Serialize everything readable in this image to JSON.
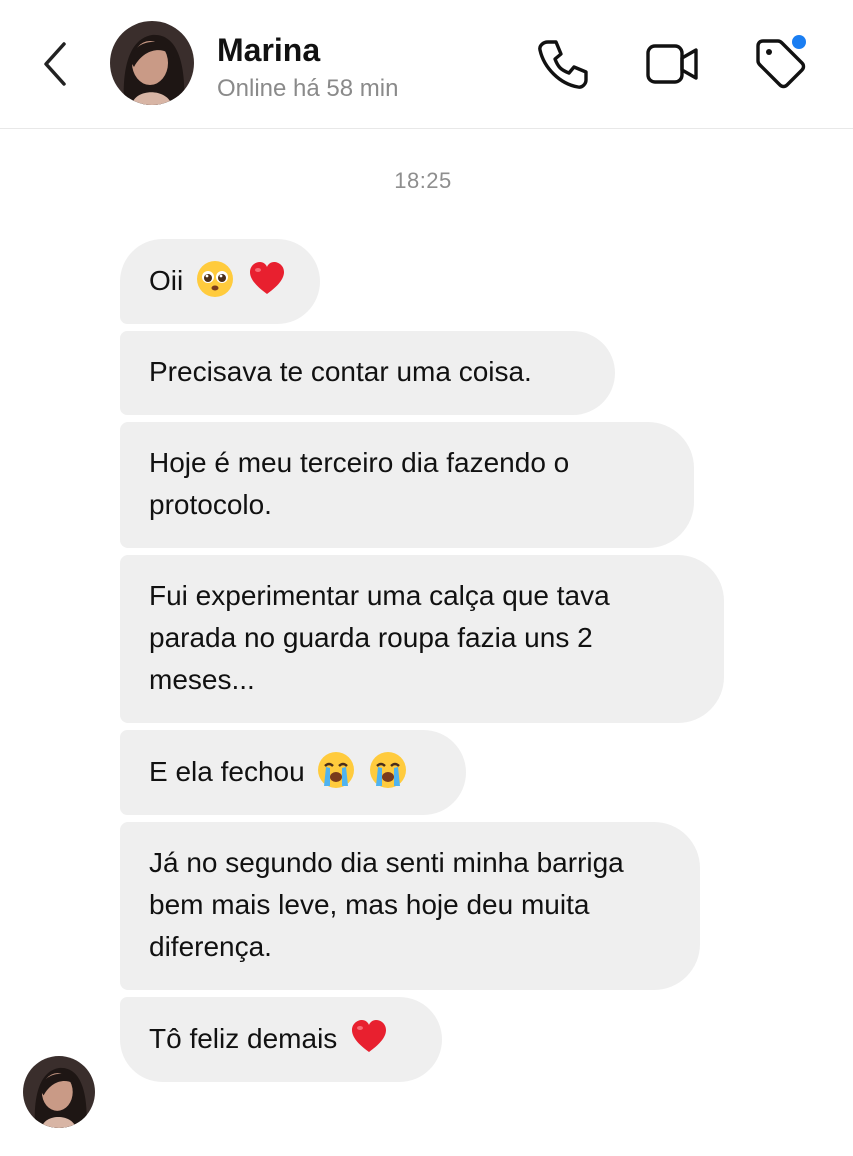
{
  "header": {
    "name": "Marina",
    "status": "Online há 58 min"
  },
  "chat": {
    "timestamp": "18:25",
    "messages": [
      {
        "text": "Oii",
        "emojis": [
          "pleading-face-emoji",
          "red-heart-emoji"
        ]
      },
      {
        "text": "Precisava te contar uma coisa.",
        "emojis": []
      },
      {
        "text": "Hoje é meu terceiro dia fazendo o protocolo.",
        "emojis": []
      },
      {
        "text": "Fui experimentar uma calça que tava parada no guarda roupa fazia uns 2 meses...",
        "emojis": []
      },
      {
        "text": "E ela fechou",
        "emojis": [
          "loudly-crying-face-emoji",
          "loudly-crying-face-emoji"
        ]
      },
      {
        "text": "Já no segundo dia senti minha barriga bem mais leve, mas hoje deu muita diferença.",
        "emojis": []
      },
      {
        "text": "Tô feliz demais",
        "emojis": [
          "red-heart-emoji"
        ]
      }
    ]
  },
  "icons": {
    "back": "chevron-left-icon",
    "phone": "phone-icon",
    "video": "video-camera-icon",
    "tag": "tag-icon"
  },
  "colors": {
    "bubble": "#efefef",
    "notification_dot": "#1a7ef2",
    "status_text": "#8a8a8a"
  }
}
